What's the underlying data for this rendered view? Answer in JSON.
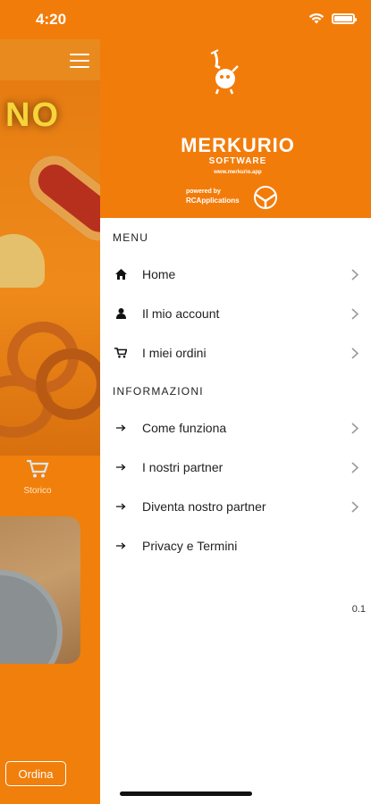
{
  "status": {
    "time": "4:20"
  },
  "background": {
    "hero_text": "NO",
    "storico_label": "Storico",
    "ordina_label": "Ordina"
  },
  "header": {
    "brand": "MERKURIO",
    "brand_sub": "SOFTWARE",
    "brand_url": "www.merkurio.app",
    "powered_by": "powered by",
    "powered_brand": "RCApplications"
  },
  "menu": {
    "title": "MENU",
    "items": [
      {
        "label": "Home",
        "icon": "home-icon"
      },
      {
        "label": "Il mio account",
        "icon": "user-icon"
      },
      {
        "label": "I miei ordini",
        "icon": "cart-icon"
      }
    ]
  },
  "info": {
    "title": "INFORMAZIONI",
    "items": [
      {
        "label": "Come funziona",
        "icon": "arrow-right-icon"
      },
      {
        "label": "I nostri partner",
        "icon": "arrow-right-icon"
      },
      {
        "label": "Diventa nostro partner",
        "icon": "arrow-right-icon"
      },
      {
        "label": "Privacy e Termini",
        "icon": "arrow-right-icon"
      }
    ]
  },
  "version": "0.1",
  "colors": {
    "accent": "#f27c0a"
  }
}
